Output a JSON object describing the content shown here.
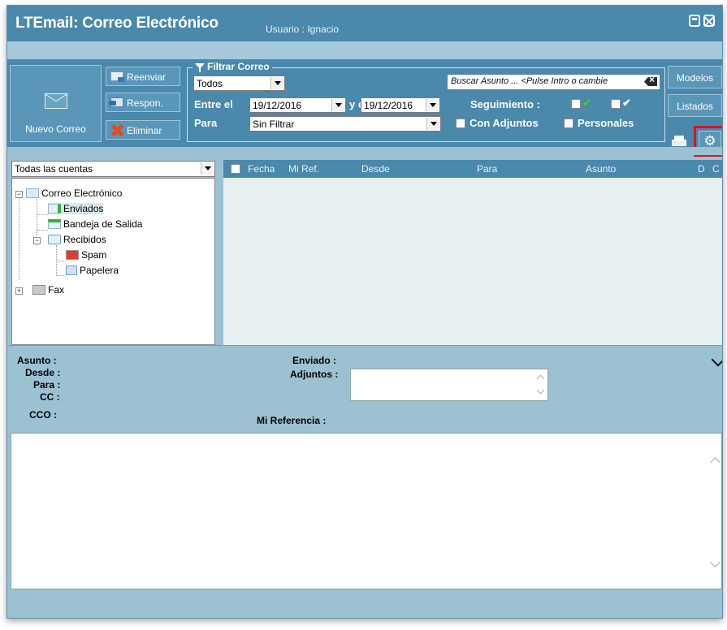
{
  "window": {
    "title": "LTEmail: Correo Electrónico",
    "user_label": "Usuario : Ignacio"
  },
  "toolbar": {
    "new_mail_label": "Nuevo Correo",
    "forward_label": "Reenviar",
    "reply_label": "Respon.",
    "delete_label": "Eliminar",
    "models_label": "Modelos",
    "lists_label": "Listados",
    "gear_glyph": "⚙"
  },
  "filter": {
    "legend": "Filtrar Correo",
    "type_value": "Todos",
    "between_label": "Entre el",
    "date_from": "19/12/2016",
    "and_label": "y el",
    "date_to": "19/12/2016",
    "for_label": "Para",
    "for_value": "Sin Filtrar",
    "search_placeholder": "Buscar Asunto ... <Pulse Intro o cambie",
    "tracking_label": "Seguimiento :",
    "attachments_label": "Con Adjuntos",
    "personal_label": "Personales",
    "check_glyph": "✔"
  },
  "accounts": {
    "selected": "Todas las cuentas"
  },
  "tree": {
    "root": "Correo Electrónico",
    "sent": "Enviados",
    "outbox": "Bandeja de Salida",
    "received": "Recibidos",
    "spam": "Spam",
    "trash": "Papelera",
    "fax": "Fax",
    "expand_minus": "−",
    "expand_plus": "+"
  },
  "grid": {
    "columns": [
      "Fecha",
      "Mi Ref.",
      "Desde",
      "Para",
      "Asunto",
      "D",
      "C"
    ]
  },
  "detail": {
    "subject_label": "Asunto :",
    "from_label": "Desde :",
    "to_label": "Para :",
    "cc_label": "CC :",
    "bcc_label": "CCO :",
    "sent_label": "Enviado :",
    "attachments_label": "Adjuntos :",
    "ref_label": "Mi Referencia :"
  },
  "colors": {
    "title_bar": "#4a88ac",
    "panel": "#9cc1d3",
    "highlight_box": "#e0141b"
  }
}
